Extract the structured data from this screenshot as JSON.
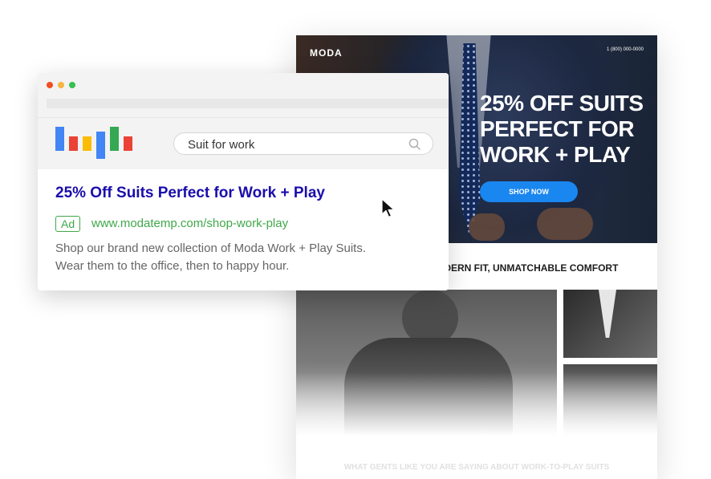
{
  "landing": {
    "brand": "MODA",
    "phone": "1 (800) 000-0000",
    "headline": [
      "25% OFF SUITS",
      "PERFECT FOR",
      "WORK + PLAY"
    ],
    "cta_label": "SHOP NOW",
    "cta_color": "#1a86f0",
    "tagline": "ODERN FIT, UNMATCHABLE COMFORT",
    "footer_heading": "WHAT GENTS LIKE YOU ARE SAYING ABOUT WORK-TO-PLAY SUITS"
  },
  "browser": {
    "window_dots": [
      "#f04e23",
      "#f7b441",
      "#37c150"
    ],
    "logo_bar_colors": [
      "#4285f4",
      "#ea4335",
      "#fbbc05",
      "#4285f4",
      "#34a853",
      "#ea4335"
    ],
    "search": {
      "query": "Suit for work",
      "icon": "search-icon"
    },
    "ad": {
      "title": "25% Off Suits Perfect for Work + Play",
      "badge": "Ad",
      "url": "www.modatemp.com/shop-work-play",
      "description_lines": [
        "Shop our brand new collection of Moda Work + Play Suits.",
        "Wear them to the office, then to happy hour."
      ],
      "title_color": "#1a0dab",
      "url_color": "#3fa84a"
    }
  }
}
